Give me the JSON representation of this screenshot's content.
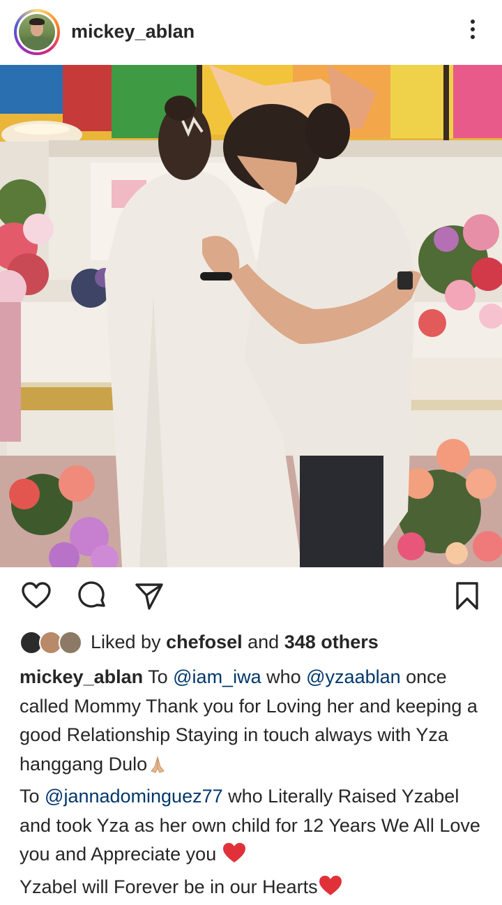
{
  "post": {
    "username": "mickey_ablan",
    "likes": {
      "prefix": "Liked by ",
      "user": "chefosel",
      "middle": " and ",
      "others": "348 others"
    },
    "caption": {
      "author": "mickey_ablan",
      "t1": " To ",
      "m1": "@iam_iwa",
      "t2": " who ",
      "m2": "@yzaablan",
      "t3": " once called Mommy Thank you for Loving her and keeping a good Relationship Staying in touch always with Yza hanggang Dulo",
      "t4": "To ",
      "m3": "@jannadominguez77",
      "t5": " who Literally Raised Yzabel and took Yza as her own child for 12 Years We All Love you and Appreciate you ",
      "t6": "Yzabel will Forever be in our Hearts"
    }
  },
  "icons": {
    "more": "more-vertical-icon",
    "like": "heart-outline-icon",
    "comment": "comment-bubble-icon",
    "share": "paper-plane-icon",
    "save": "bookmark-icon",
    "pray": "folded-hands-emoji",
    "heart": "red-heart-emoji"
  },
  "colors": {
    "text": "#262626",
    "mention": "#00376b",
    "heart": "#e0313b"
  }
}
